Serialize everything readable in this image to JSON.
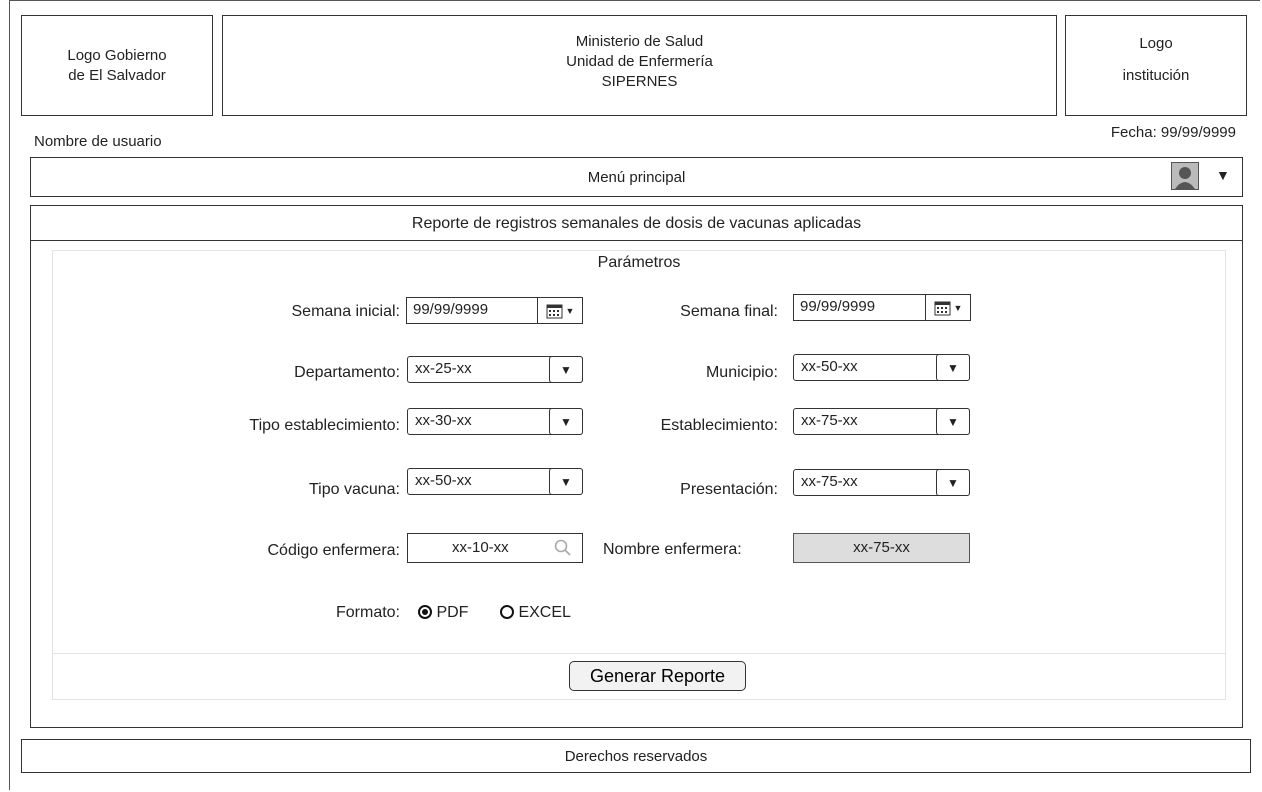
{
  "header": {
    "logo_left": [
      "Logo Gobierno",
      "de El Salvador"
    ],
    "center": [
      "Ministerio de Salud",
      "Unidad de Enfermería",
      "SIPERNES"
    ],
    "logo_right": [
      "Logo",
      "institución"
    ]
  },
  "user": {
    "name": "Nombre de usuario",
    "date": "Fecha: 99/99/9999"
  },
  "menu": {
    "label": "Menú principal",
    "user_icon": "user-icon",
    "dropdown": "▼"
  },
  "report": {
    "title": "Reporte de registros semanales de dosis de vacunas aplicadas",
    "params_title": "Parámetros",
    "semana_inicial": {
      "label": "Semana inicial:",
      "value": "99/99/9999"
    },
    "semana_final": {
      "label": "Semana final:",
      "value": "99/99/9999"
    },
    "departamento": {
      "label": "Departamento:",
      "value": "xx-25-xx"
    },
    "municipio": {
      "label": "Municipio:",
      "value": "xx-50-xx"
    },
    "tipo_establecimiento": {
      "label": "Tipo establecimiento:",
      "value": "xx-30-xx"
    },
    "establecimiento": {
      "label": "Establecimiento:",
      "value": "xx-75-xx"
    },
    "tipo_vacuna": {
      "label": "Tipo vacuna:",
      "value": "xx-50-xx"
    },
    "presentacion": {
      "label": "Presentación:",
      "value": "xx-75-xx"
    },
    "codigo_enfermera": {
      "label": "Código enfermera:",
      "value": "xx-10-xx"
    },
    "nombre_enfermera": {
      "label": "Nombre enfermera:",
      "value": "xx-75-xx"
    },
    "formato": {
      "label": "Formato:",
      "options": [
        "PDF",
        "EXCEL"
      ],
      "selected": "PDF"
    },
    "generate_button": "Generar Reporte"
  },
  "footer": {
    "text": "Derechos reservados"
  }
}
